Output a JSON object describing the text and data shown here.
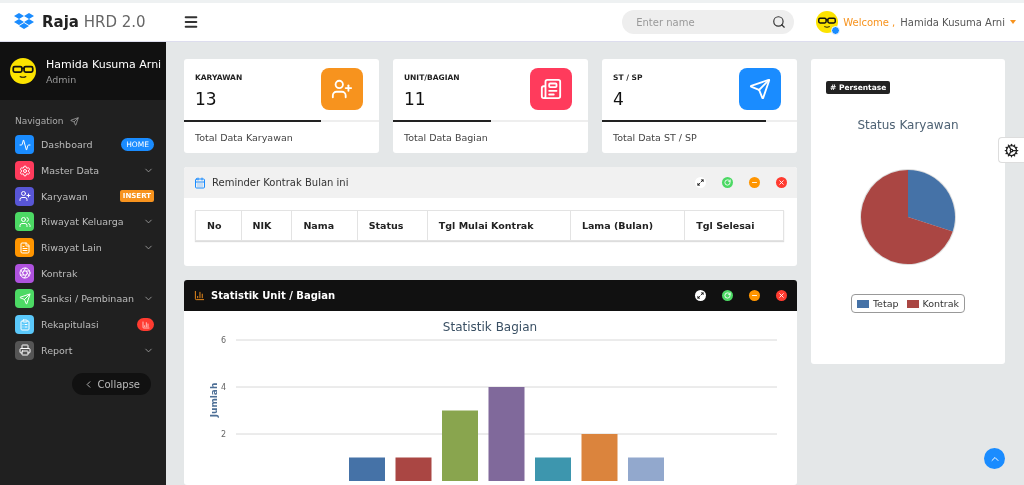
{
  "header": {
    "brand": "**Raja** HRD 2.0",
    "search": {
      "placeholder": "Enter name"
    },
    "welcome_label": "Welcome ,",
    "user_name": "Hamida Kusuma Arni",
    "online": true
  },
  "sidebar": {
    "profile": {
      "name": "Hamida Kusuma Arni",
      "role": "Admin"
    },
    "section_label": "Navigation",
    "items": [
      {
        "label": "Dashboard",
        "color": "#1a8cff",
        "has_submenu": false,
        "badge": {
          "kind": "pill",
          "text": "HOME"
        }
      },
      {
        "label": "Master Data",
        "color": "#ff3b5c",
        "has_submenu": true
      },
      {
        "label": "Karyawan",
        "color": "#5856d6",
        "has_submenu": false,
        "badge": {
          "kind": "tag",
          "text": "INSERT"
        }
      },
      {
        "label": "Riwayat Keluarga",
        "color": "#4cd964",
        "has_submenu": true
      },
      {
        "label": "Riwayat Lain",
        "color": "#ff9500",
        "has_submenu": true
      },
      {
        "label": "Kontrak",
        "color": "#af52de",
        "has_submenu": false
      },
      {
        "label": "Sanksi / Pembinaan",
        "color": "#4cd964",
        "has_submenu": true
      },
      {
        "label": "Rekapitulasi",
        "color": "#5ac8fa",
        "has_submenu": false,
        "badge": {
          "kind": "chart"
        }
      },
      {
        "label": "Report",
        "color": "#555555",
        "has_submenu": true
      }
    ],
    "collapse_button": "Collapse"
  },
  "stat_cards": [
    {
      "title": "KARYAWAN",
      "value": "13",
      "footer": "Total Data Karyawan",
      "color": "#f7931e",
      "level": 0.7
    },
    {
      "title": "UNIT/BAGIAN",
      "value": "11",
      "footer": "Total Data Bagian",
      "color": "#ff3b5c",
      "level": 0.5
    },
    {
      "title": "ST / SP",
      "value": "4",
      "footer": "Total Data ST / SP",
      "color": "#1a8cff",
      "level": 0.84
    }
  ],
  "reminder_panel": {
    "title": "Reminder Kontrak Bulan ini",
    "columns": [
      "No",
      "NIK",
      "Nama",
      "Status",
      "Tgl Mulai Kontrak",
      "Lama (Bulan)",
      "Tgl Selesai"
    ]
  },
  "stats_panel": {
    "title": "Statistik Unit / Bagian",
    "chart_data": {
      "type": "bar",
      "title": "Statistik Bagian",
      "ylabel": "Jumlah",
      "yticks": [
        2,
        4,
        6
      ],
      "ylim": [
        0,
        6
      ],
      "series": [
        {
          "color": "#4572a7",
          "values": [
            1
          ]
        },
        {
          "color": "#aa4643",
          "values": [
            1
          ]
        },
        {
          "color": "#89a54e",
          "values": [
            3
          ]
        },
        {
          "color": "#80699b",
          "values": [
            4
          ]
        },
        {
          "color": "#3d96ae",
          "values": [
            1
          ]
        },
        {
          "color": "#db843d",
          "values": [
            2
          ]
        },
        {
          "color": "#92a8cd",
          "values": [
            1
          ]
        }
      ]
    }
  },
  "status_panel": {
    "badge": "# Persentase",
    "title": "Status Karyawan",
    "legend": [
      {
        "label": "Tetap",
        "color": "#4572a7"
      },
      {
        "label": "Kontrak",
        "color": "#aa4643"
      }
    ]
  }
}
